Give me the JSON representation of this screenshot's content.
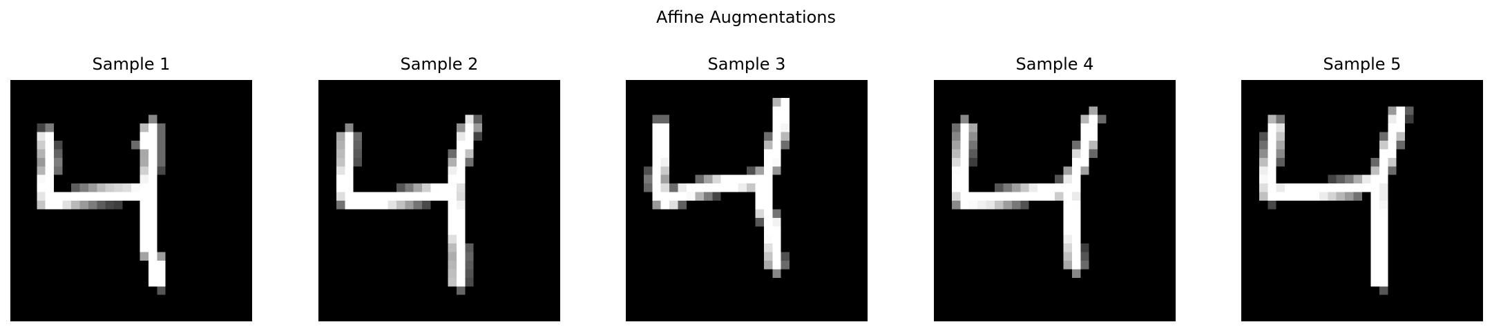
{
  "figure": {
    "title": "Affine Augmentations"
  },
  "samples": [
    {
      "title": "Sample 1"
    },
    {
      "title": "Sample 2"
    },
    {
      "title": "Sample 3"
    },
    {
      "title": "Sample 4"
    },
    {
      "title": "Sample 5"
    }
  ],
  "colors": {
    "background": "#ffffff",
    "image_background": "#000000",
    "stroke": "#ffffff"
  }
}
